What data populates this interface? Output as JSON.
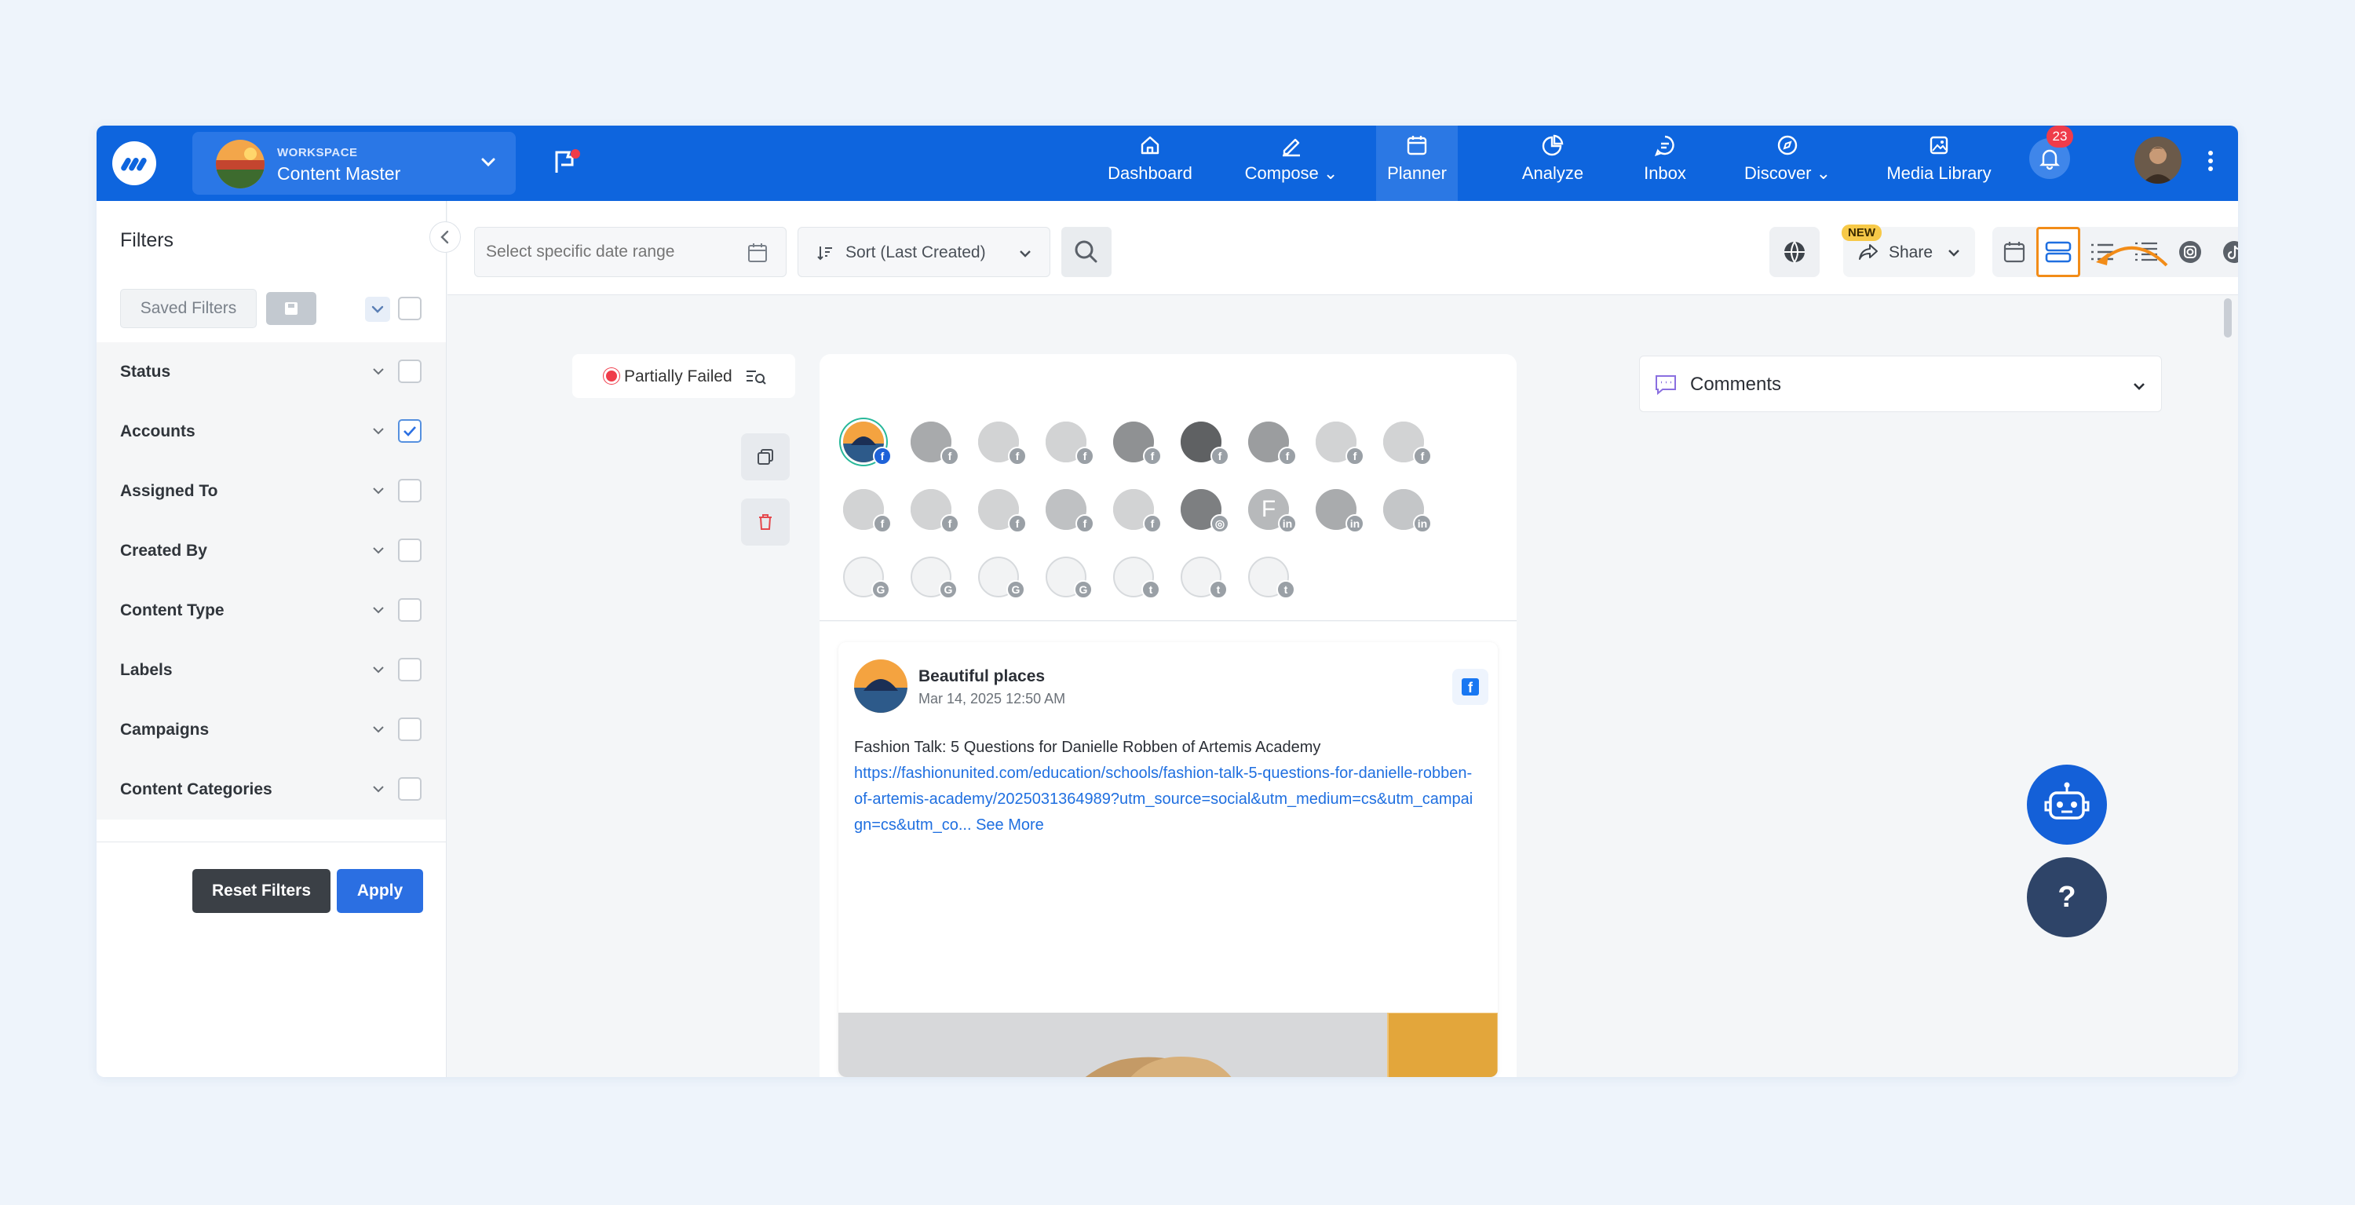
{
  "workspace": {
    "label": "WORKSPACE",
    "name": "Content Master"
  },
  "nav": {
    "dashboard": "Dashboard",
    "compose": "Compose",
    "planner": "Planner",
    "analyze": "Analyze",
    "inbox": "Inbox",
    "discover": "Discover",
    "media_library": "Media Library"
  },
  "notifications": {
    "count": "23"
  },
  "sidebar": {
    "title": "Filters",
    "saved_filters": "Saved Filters",
    "filters": [
      {
        "label": "Status",
        "checked": false
      },
      {
        "label": "Accounts",
        "checked": true
      },
      {
        "label": "Assigned To",
        "checked": false
      },
      {
        "label": "Created By",
        "checked": false
      },
      {
        "label": "Content Type",
        "checked": false
      },
      {
        "label": "Labels",
        "checked": false
      },
      {
        "label": "Campaigns",
        "checked": false
      },
      {
        "label": "Content Categories",
        "checked": false
      }
    ],
    "reset_label": "Reset Filters",
    "apply_label": "Apply"
  },
  "toolbar": {
    "date_placeholder": "Select specific date range",
    "sort_label": "Sort (Last Created)",
    "new_badge": "NEW",
    "share_label": "Share"
  },
  "post_status": {
    "label": "Partially Failed"
  },
  "account_letter": "F",
  "post": {
    "account_name": "Beautiful places",
    "date": "Mar 14, 2025 12:50 AM",
    "text": "Fashion Talk: 5 Questions for Danielle Robben of Artemis Academy",
    "link": "https://fashionunited.com/education/schools/fashion-talk-5-questions-for-danielle-robben-of-artemis-academy/2025031364989?utm_source=social&utm_medium=cs&utm_campaign=cs&utm_co...",
    "see_more": "See More"
  },
  "comments": {
    "label": "Comments"
  },
  "help": {
    "label": "?"
  },
  "colors": {
    "brand": "#0e65de",
    "accent_highlight": "#f28c18",
    "danger": "#ef3c4a"
  }
}
